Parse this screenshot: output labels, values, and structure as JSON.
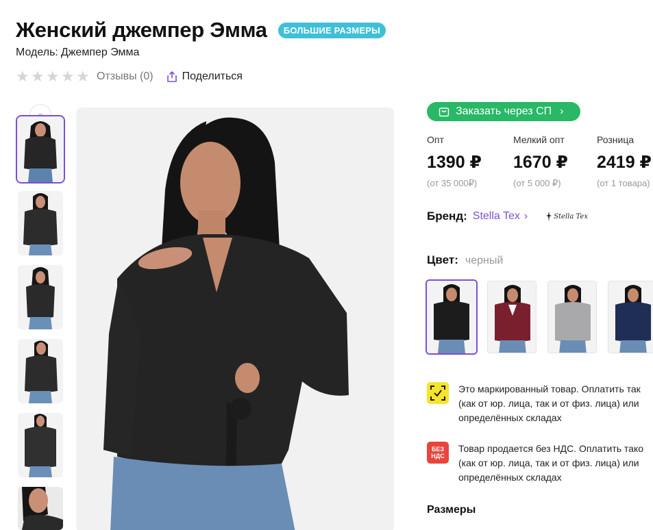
{
  "product": {
    "title": "Женский джемпер Эмма",
    "badge": "БОЛЬШИЕ РАЗМЕРЫ",
    "model_label": "Модель:",
    "model_value": "Джемпер Эмма"
  },
  "rating": {
    "stars_filled": 0,
    "stars_total": 5,
    "reviews_label": "Отзывы (0)",
    "share_label": "Поделиться"
  },
  "gallery": {
    "thumbnails": [
      "thumb-1",
      "thumb-2",
      "thumb-3",
      "thumb-4",
      "thumb-5",
      "thumb-6"
    ],
    "active_index": 0
  },
  "order": {
    "button_label": "Заказать через СП"
  },
  "prices": [
    {
      "label": "Опт",
      "value": "1390 ₽",
      "min": "(от 35 000₽)"
    },
    {
      "label": "Мелкий опт",
      "value": "1670 ₽",
      "min": "(от 5 000 ₽)"
    },
    {
      "label": "Розница",
      "value": "2419 ₽",
      "min": "(от 1 товара)"
    }
  ],
  "brand": {
    "label": "Бренд:",
    "name": "Stella Tex",
    "logo_text": "Stella Tex"
  },
  "color": {
    "label": "Цвет:",
    "value": "черный",
    "options": [
      {
        "name": "black",
        "hex": "#1c1c1c",
        "active": true
      },
      {
        "name": "burgundy",
        "hex": "#7a1f2e",
        "active": false
      },
      {
        "name": "gray",
        "hex": "#a9a9ab",
        "active": false
      },
      {
        "name": "navy",
        "hex": "#1f2e55",
        "active": false
      }
    ]
  },
  "info": [
    {
      "icon": "datamatrix-check-icon",
      "lines": [
        "Это маркированный товар. Оплатить так",
        "(как от юр. лица, так и от физ. лица) или",
        "определённых складах"
      ]
    },
    {
      "icon": "no-vat-icon",
      "icon_text": [
        "БЕЗ",
        "НДС"
      ],
      "lines": [
        "Товар продается без НДС. Оплатить тако",
        "(как от юр. лица, так и от физ. лица) или",
        "определённых складах"
      ]
    }
  ],
  "sizes": {
    "label": "Размеры"
  },
  "colors": {
    "accent": "#7b4fd6",
    "order_green": "#28b866",
    "badge_cyan": "#3fc0d8",
    "mark_yellow": "#f6e42a",
    "vat_red": "#e8453c"
  }
}
